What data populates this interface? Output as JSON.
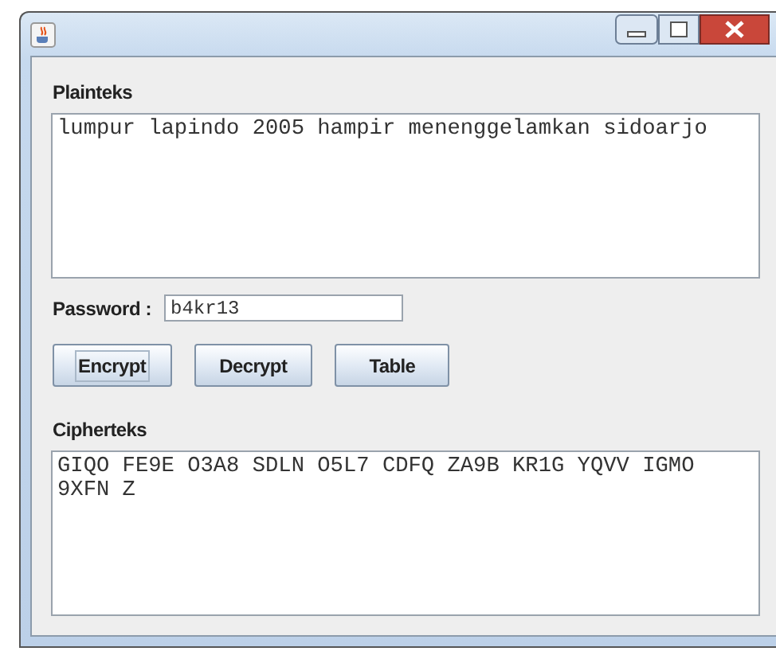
{
  "plain": {
    "label": "Plainteks",
    "value": "lumpur lapindo 2005 hampir menenggelamkan sidoarjo"
  },
  "password": {
    "label": "Password :",
    "value": "b4kr13"
  },
  "buttons": [
    {
      "label": "Encrypt",
      "focused": true
    },
    {
      "label": "Decrypt",
      "focused": false
    },
    {
      "label": "Table",
      "focused": false
    }
  ],
  "cipher": {
    "label": "Cipherteks",
    "value": "GIQO FE9E O3A8 SDLN O5L7 CDFQ ZA9B KR1G YQVV IGMO 9XFN Z"
  }
}
